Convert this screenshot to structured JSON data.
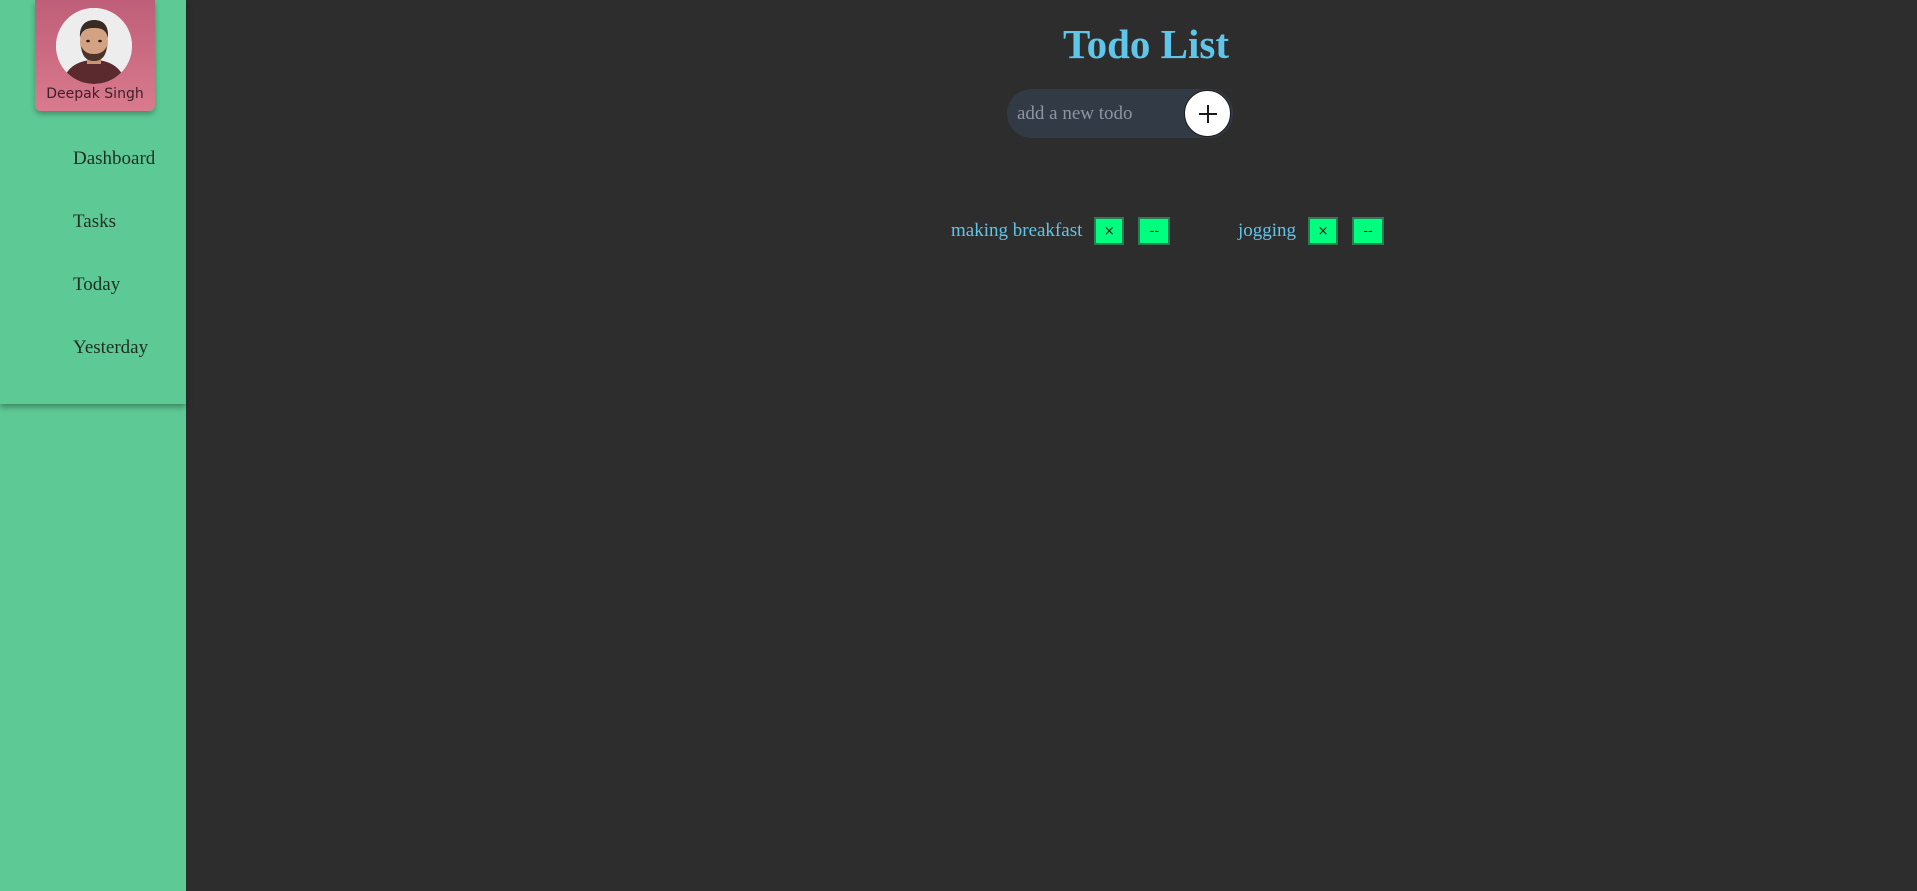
{
  "profile": {
    "name": "Deepak Singh"
  },
  "sidebar": {
    "items": [
      {
        "label": "Dashboard"
      },
      {
        "label": "Tasks"
      },
      {
        "label": "Today"
      },
      {
        "label": "Yesterday"
      }
    ]
  },
  "header": {
    "title": "Todo List"
  },
  "add_form": {
    "placeholder": "add a new todo",
    "value": "",
    "button_icon": "plus-icon"
  },
  "todos": [
    {
      "text": "making breakfast",
      "delete_label": "×",
      "edit_label": "--"
    },
    {
      "text": "jogging",
      "delete_label": "×",
      "edit_label": "--"
    }
  ],
  "colors": {
    "sidebar": "#5dca95",
    "background": "#2d2d2d",
    "title": "#5fc6ea",
    "todo_button": "#00ff7f",
    "profile_card": "#d97a8e"
  }
}
